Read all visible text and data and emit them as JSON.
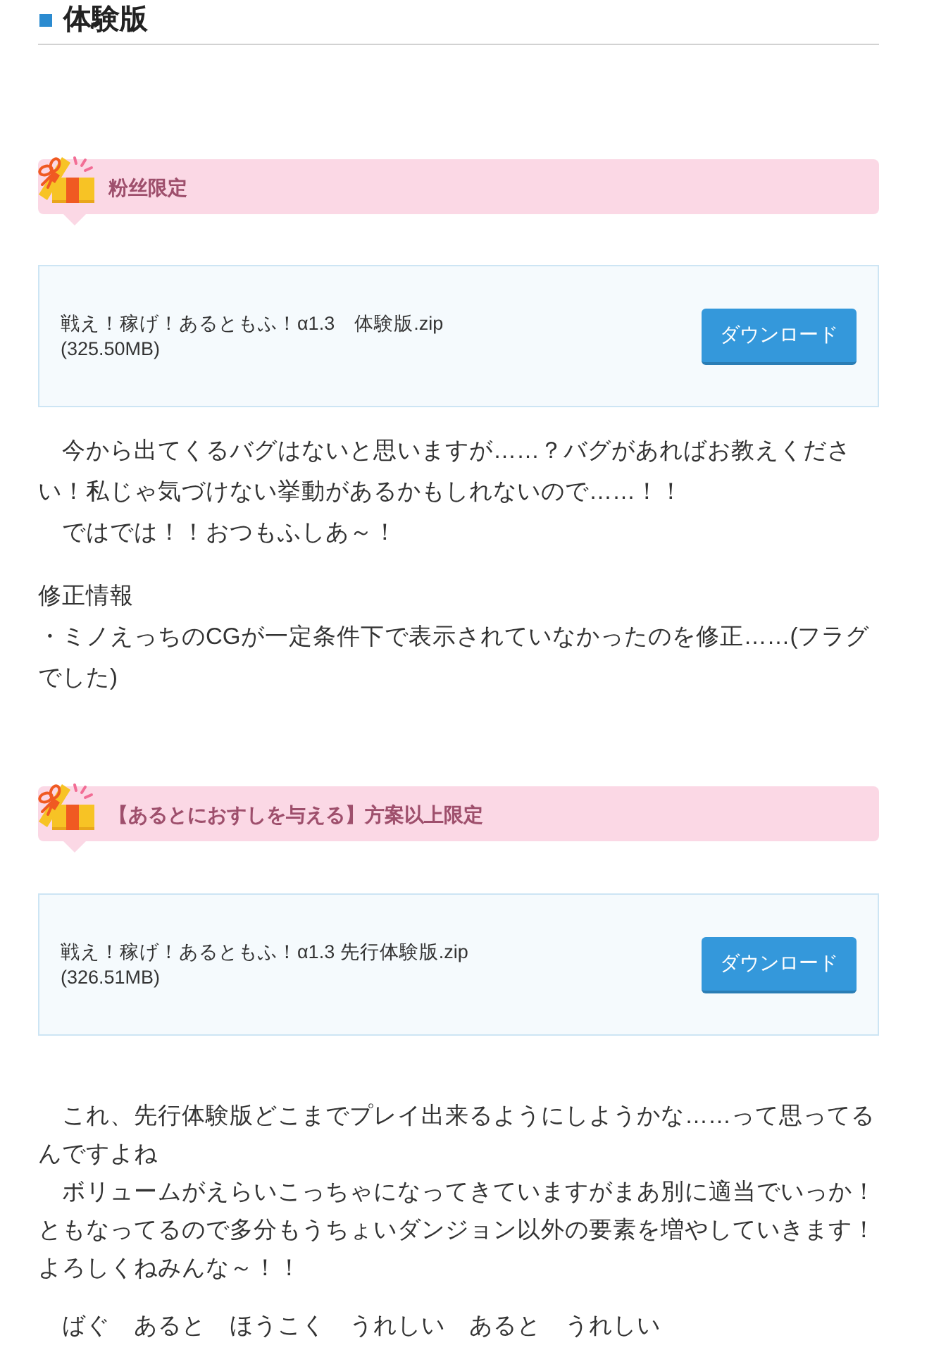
{
  "section": {
    "title": "体験版"
  },
  "tiers": [
    {
      "banner": {
        "label": "粉丝限定"
      },
      "download": {
        "filename": "戦え！稼げ！あるともふ！α1.3　体験版.zip",
        "size": "(325.50MB)",
        "button": "ダウンロード"
      },
      "paragraphs": [
        [
          "　今から出てくるバグはないと思いますが……？バグがあればお教えください！私じゃ気づけない挙動があるかもしれないので……！！",
          "　ではでは！！おつもふしあ～！"
        ],
        [
          "修正情報",
          "・ミノえっちのCGが一定条件下で表示されていなかったのを修正……(フラグでした)"
        ]
      ]
    },
    {
      "banner": {
        "label": "【あるとにおすしを与える】方案以上限定"
      },
      "download": {
        "filename": "戦え！稼げ！あるともふ！α1.3 先行体験版.zip",
        "size": "(326.51MB)",
        "button": "ダウンロード"
      },
      "paragraphs": [
        [
          "　これ、先行体験版どこまでプレイ出来るようにしようかな……って思ってるんですよね",
          "　ボリュームがえらいこっちゃになってきていますがまあ別に適当でいっか！",
          "ともなってるので多分もうちょいダンジョン以外の要素を増やしていきます！",
          "よろしくねみんな～！！"
        ],
        [
          "　ばぐ　あると　ほうこく　うれしい　あると　うれしい"
        ]
      ]
    }
  ]
}
